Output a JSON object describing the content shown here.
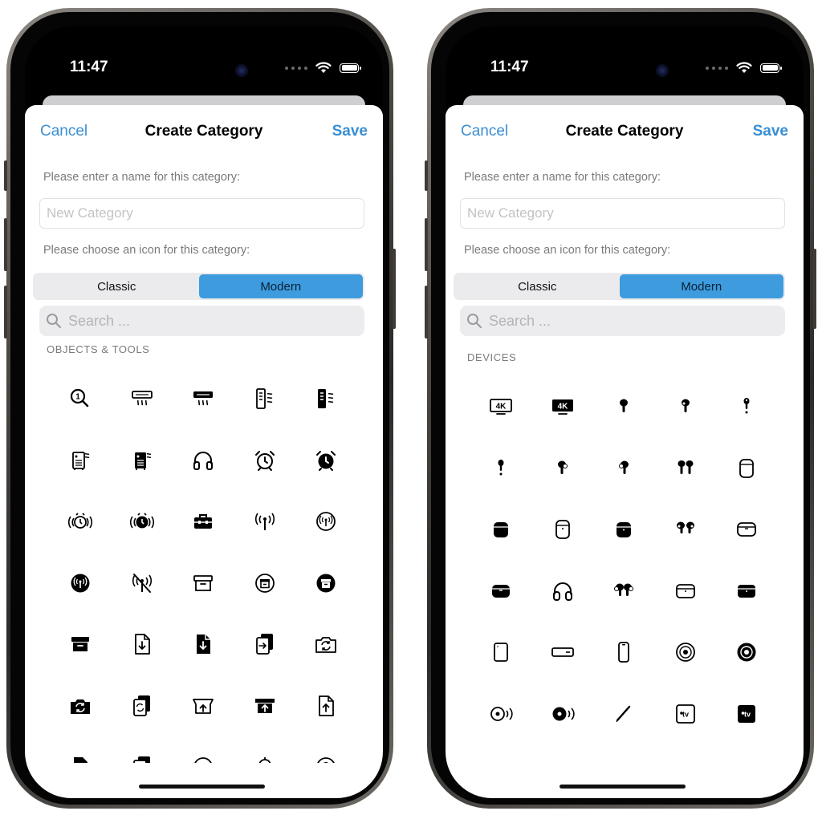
{
  "screens": [
    {
      "status_time": "11:47",
      "nav": {
        "cancel": "Cancel",
        "title": "Create Category",
        "save": "Save"
      },
      "name_prompt": "Please enter a name for this category:",
      "name_placeholder": "New Category",
      "icon_prompt": "Please choose an icon for this category:",
      "segments": {
        "classic": "Classic",
        "modern": "Modern",
        "selected": "Modern"
      },
      "search_placeholder": "Search ...",
      "section_title": "OBJECTS & TOOLS",
      "icons": [
        "magnifyingglass-1-icon",
        "air-conditioner-icon",
        "air-conditioner-filled-icon",
        "air-purifier-icon",
        "air-purifier-filled-icon",
        "dehumidifier-icon",
        "dehumidifier-filled-icon",
        "headphones-icon",
        "alarm-icon",
        "alarm-filled-icon",
        "alarm-waves-icon",
        "alarm-waves-filled-icon",
        "toolbox-icon",
        "antenna-icon",
        "antenna-circle-icon",
        "antenna-circle-filled-icon",
        "antenna-slash-icon",
        "archivebox-icon",
        "archivebox-circle-icon",
        "archivebox-circle-filled-icon",
        "archivebox-filled-icon",
        "doc-arrow-down-icon",
        "doc-arrow-down-filled-icon",
        "doc-arrow-right-icon",
        "camera-rotate-icon",
        "camera-rotate-filled-icon",
        "doc-rotate-icon",
        "tray-arrow-up-icon",
        "tray-arrow-up-filled-icon",
        "doc-arrow-up-icon",
        "doc-filled-partial-icon",
        "doc-stack-partial-icon",
        "gauge-partial-icon",
        "bell-partial-icon",
        "circle-partial-icon"
      ]
    },
    {
      "status_time": "11:47",
      "nav": {
        "cancel": "Cancel",
        "title": "Create Category",
        "save": "Save"
      },
      "name_prompt": "Please enter a name for this category:",
      "name_placeholder": "New Category",
      "icon_prompt": "Please choose an icon for this category:",
      "segments": {
        "classic": "Classic",
        "modern": "Modern",
        "selected": "Modern"
      },
      "search_placeholder": "Search ...",
      "section_title": "DEVICES",
      "icons": [
        "4k-tv-icon",
        "4k-tv-filled-icon",
        "airpod-right-icon",
        "airpod-left-icon",
        "airpod-side-icon",
        "airpod-side-2-icon",
        "airpod-gen3-right-icon",
        "airpod-gen3-left-icon",
        "airpods-icon",
        "airpods-case-icon",
        "airpods-case-filled-icon",
        "airpods-case-gen2-icon",
        "airpods-case-gen2-filled-icon",
        "airpods-pro-icon",
        "airpods-pro-case-icon",
        "airpods-pro-case-filled-icon",
        "airpods-max-icon",
        "airpods-gen3-icon",
        "airpods-gen3-case-icon",
        "airpods-gen3-case-filled-icon",
        "ipad-icon",
        "apple-tv-remote-icon",
        "iphone-icon",
        "homepod-mini-icon",
        "homepod-mini-filled-icon",
        "homepod-waves-icon",
        "homepod-waves-filled-icon",
        "pencil-icon",
        "appletv-icon",
        "appletv-filled-icon",
        "device-partial-icon",
        "device-partial-2-icon",
        "device-partial-3-icon",
        "device-partial-4-icon",
        "device-partial-5-icon"
      ]
    }
  ],
  "colors": {
    "accent": "#3a8fd3",
    "segment_active": "#3d9bde",
    "label": "#7a7a7a"
  }
}
